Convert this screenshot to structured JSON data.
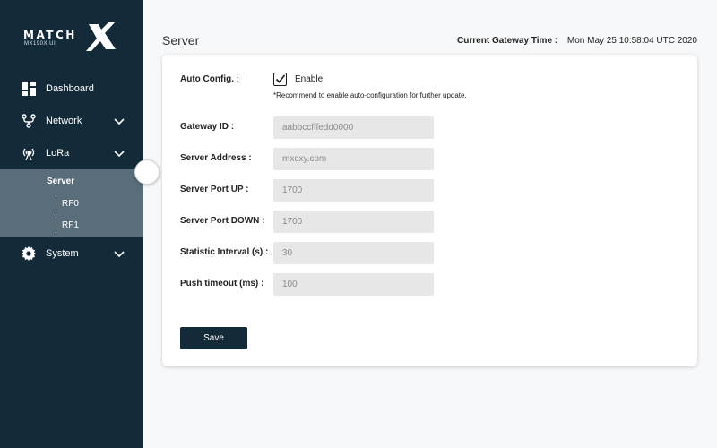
{
  "brand": {
    "name": "MATCH",
    "sub": "MX190X UI"
  },
  "sidebar": {
    "items": [
      {
        "label": "Dashboard",
        "icon": "dashboard-icon"
      },
      {
        "label": "Network",
        "icon": "network-icon"
      },
      {
        "label": "LoRa",
        "icon": "lora-antenna-icon"
      },
      {
        "label": "System",
        "icon": "gear-icon"
      }
    ],
    "lora_sub": {
      "server": "Server",
      "rf0": "RF0",
      "rf1": "RF1"
    }
  },
  "header": {
    "title": "Server",
    "time_label": "Current Gateway Time :",
    "time_value": "Mon May 25 10:58:04 UTC 2020"
  },
  "form": {
    "auto_config_label": "Auto Config. :",
    "auto_config_checked": true,
    "enable_label": "Enable",
    "hint": "*Recommend to enable auto-configuration for further update.",
    "fields": [
      {
        "label": "Gateway ID :",
        "value": "aabbccfffedd0000"
      },
      {
        "label": "Server Address :",
        "value": "mxcxy.com"
      },
      {
        "label": "Server Port UP :",
        "value": "1700"
      },
      {
        "label": "Server Port DOWN :",
        "value": "1700"
      },
      {
        "label": "Statistic Interval (s) :",
        "value": "30"
      },
      {
        "label": "Push timeout (ms) :",
        "value": "100"
      }
    ],
    "save_label": "Save"
  },
  "colors": {
    "sidebar_bg": "#132a39",
    "submenu_bg": "#5a6d7a",
    "input_bg": "#e7e7e7",
    "page_bg": "#f7f8f9"
  }
}
